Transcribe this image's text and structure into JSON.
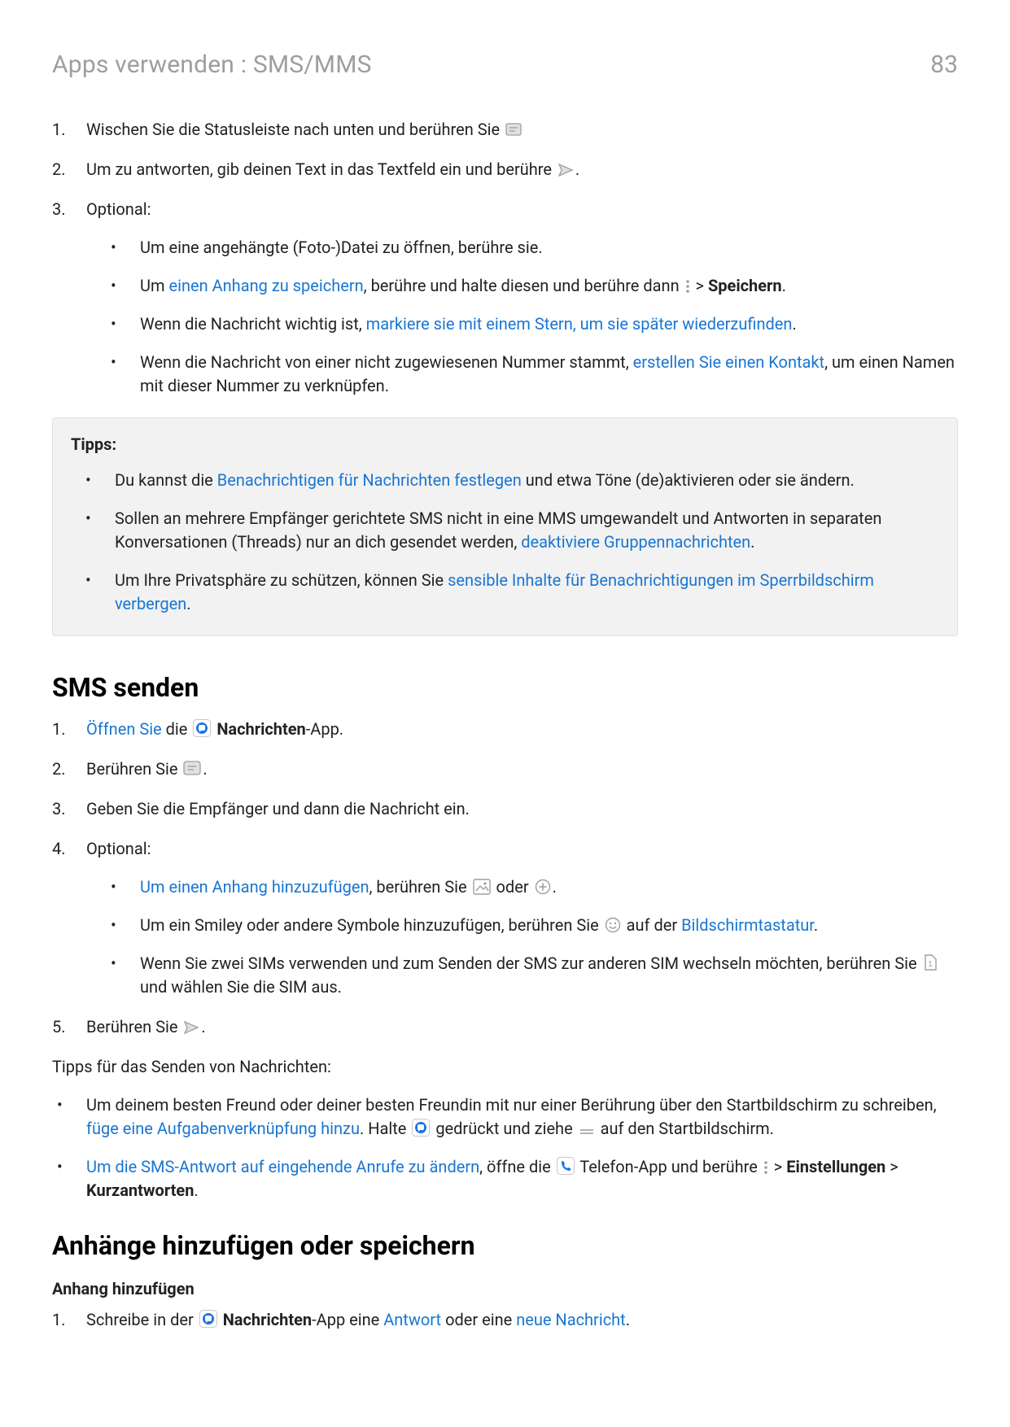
{
  "header": {
    "title": "Apps verwenden : SMS/MMS",
    "page_number": "83"
  },
  "section1": {
    "item1": "Wischen Sie die Statusleiste nach unten und berühren Sie ",
    "item2_a": "Um zu antworten, gib deinen Text in das Textfeld ein und berühre ",
    "item2_b": ".",
    "item3": "Optional:",
    "item3_bul1": "Um eine angehängte (Foto-)Datei zu öffnen, berühre sie.",
    "item3_bul2_a": "Um ",
    "item3_bul2_link": "einen Anhang zu speichern",
    "item3_bul2_b": ", berühre und halte diesen und berühre dann ",
    "item3_bul2_c": " > ",
    "item3_bul2_bold": "Speichern",
    "item3_bul2_d": ".",
    "item3_bul3_a": "Wenn die Nachricht wichtig ist, ",
    "item3_bul3_link": "markiere sie mit einem Stern, um sie später wiederzufinden",
    "item3_bul3_b": ".",
    "item3_bul4_a": "Wenn die Nachricht von einer nicht zugewiesenen Nummer stammt, ",
    "item3_bul4_link": "erstellen Sie einen Kontakt",
    "item3_bul4_b": ", um einen Namen mit dieser Nummer zu verknüpfen."
  },
  "tips": {
    "title": "Tipps:",
    "t1_a": "Du kannst die ",
    "t1_link": "Benachrichtigen für Nachrichten festlegen",
    "t1_b": " und etwa Töne (de)aktivieren oder sie ändern.",
    "t2_a": "Sollen an mehrere Empfänger gerichtete SMS nicht in eine MMS umgewandelt und Antworten in separaten Konversationen (Threads) nur an dich gesendet werden, ",
    "t2_link": "deaktiviere Gruppennachrichten",
    "t2_b": ".",
    "t3_a": "Um Ihre Privatsphäre zu schützen, können Sie ",
    "t3_link": "sensible Inhalte für Benachrichtigungen im Sperrbildschirm verbergen",
    "t3_b": "."
  },
  "section2": {
    "heading": "SMS senden",
    "s1_link": "Öffnen Sie",
    "s1_a": " die ",
    "s1_bold": "Nachrichten",
    "s1_b": "-App.",
    "s2_a": "Berühren Sie ",
    "s2_b": ".",
    "s3": "Geben Sie die Empfänger und dann die Nachricht ein.",
    "s4": "Optional:",
    "s4_b1_link": "Um einen Anhang hinzuzufügen",
    "s4_b1_a": ", berühren Sie ",
    "s4_b1_b": " oder ",
    "s4_b1_c": ".",
    "s4_b2_a": "Um ein Smiley oder andere Symbole hinzuzufügen, berühren Sie ",
    "s4_b2_b": " auf der ",
    "s4_b2_link": "Bildschirmtastatur",
    "s4_b2_c": ".",
    "s4_b3_a": "Wenn Sie zwei SIMs verwenden und zum Senden der SMS zur anderen SIM wechseln möchten, berühren Sie ",
    "s4_b3_b": " und wählen Sie die SIM aus.",
    "s5_a": "Berühren Sie ",
    "s5_b": ".",
    "tips_para": "Tipps für das Senden von Nachrichten:",
    "p1_a": "Um deinem besten Freund oder deiner besten Freundin mit nur einer Berührung über den Startbildschirm zu schreiben, ",
    "p1_link": "füge eine Aufgabenverknüpfung hinzu",
    "p1_b": ". Halte ",
    "p1_c": " gedrückt und ziehe ",
    "p1_d": " auf den Startbildschirm.",
    "p2_link": "Um die SMS-Antwort auf eingehende Anrufe zu ändern",
    "p2_a": ", öffne die ",
    "p2_b": " Telefon-App und berühre ",
    "p2_c": " > ",
    "p2_bold1": "Einstellungen",
    "p2_gt": " > ",
    "p2_bold2": "Kurzantworten",
    "p2_d": "."
  },
  "section3": {
    "heading": "Anhänge hinzufügen oder speichern",
    "sub": "Anhang hinzufügen",
    "i1_a": "Schreibe in der ",
    "i1_bold": "Nachrichten",
    "i1_b": "-App eine ",
    "i1_link1": "Antwort",
    "i1_c": " oder eine ",
    "i1_link2": "neue Nachricht",
    "i1_d": "."
  }
}
